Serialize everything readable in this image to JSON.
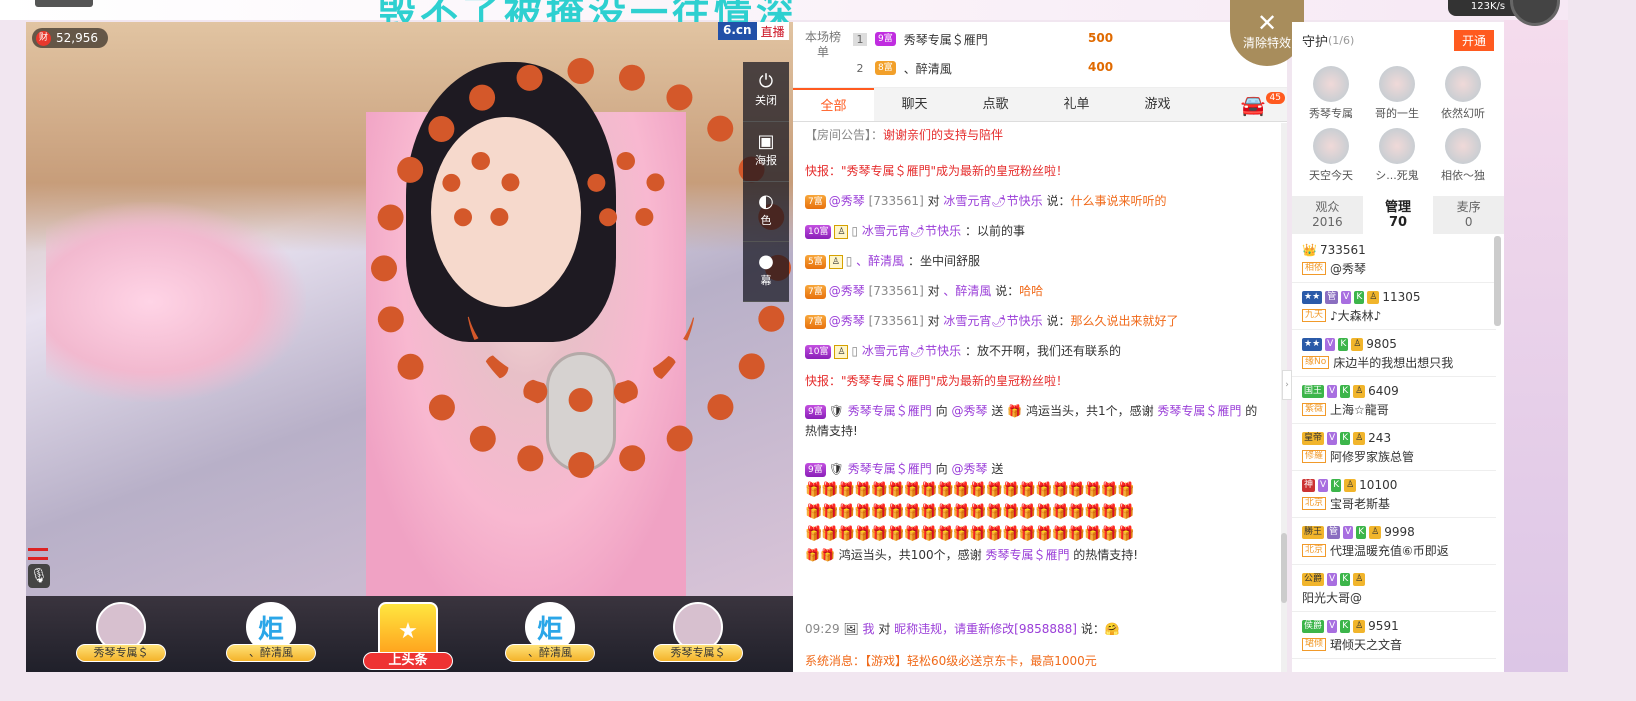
{
  "banner": {
    "text": "毁不了被掩没一往情深"
  },
  "video": {
    "wealth": "52,956",
    "wealth_icon": "财",
    "logo": "6.cn",
    "live": "直播"
  },
  "side_buttons": [
    {
      "label": "关闭",
      "icon": "power-icon"
    },
    {
      "label": "海报",
      "icon": "poster-icon"
    },
    {
      "label": "色",
      "icon": "palette-icon"
    },
    {
      "label": "幕",
      "icon": "screen-icon"
    }
  ],
  "gift_bar": [
    {
      "label": "秀琴专属＄"
    },
    {
      "label": "、醉清風",
      "glyph": "炬"
    },
    {
      "label": "上头条",
      "glyph": "★"
    },
    {
      "label": "、醉清風",
      "glyph": "炬"
    },
    {
      "label": "秀琴专属＄"
    }
  ],
  "rank": {
    "label": "本场榜单",
    "rows": [
      {
        "num": "1",
        "level": "9富",
        "name": "秀琴专属＄雁門",
        "coins": "500"
      },
      {
        "num": "2",
        "level": "8富",
        "name": "、醉清風",
        "coins": "400"
      }
    ]
  },
  "close_effects": "清除特效",
  "tabs": [
    {
      "label": "全部"
    },
    {
      "label": "聊天"
    },
    {
      "label": "点歌"
    },
    {
      "label": "礼单"
    },
    {
      "label": "游戏"
    }
  ],
  "car_badge": "45",
  "chat": {
    "notice_label": "【房间公告】：",
    "notice_text": "谢谢亲们的支持与陪伴",
    "flash1": "快报：\"秀琴专属＄雁門\"成为最新的皇冠粉丝啦！",
    "m1": {
      "level": "7富",
      "from": "@秀琴",
      "id": "[733561]",
      "to_word": "对",
      "to": "冰雪元宵🌶节快乐",
      "say": "说：",
      "text": "什么事说来听听的"
    },
    "m2": {
      "level": "10富",
      "name": "冰雪元宵🌶节快乐",
      "text": "：以前的事"
    },
    "m3": {
      "level": "5富",
      "name": "、醉清風",
      "text": "：坐中间舒服"
    },
    "m4": {
      "level": "7富",
      "from": "@秀琴",
      "id": "[733561]",
      "to_word": "对",
      "to": "、醉清風",
      "say": "说：",
      "text": "哈哈"
    },
    "m5": {
      "level": "7富",
      "from": "@秀琴",
      "id": "[733561]",
      "to_word": "对",
      "to": "冰雪元宵🌶节快乐",
      "say": "说：",
      "text": "那么久说出来就好了"
    },
    "m6": {
      "level": "10富",
      "name": "冰雪元宵🌶节快乐",
      "text": "：放不开啊，我们还有联系的"
    },
    "flash2": "快报：\"秀琴专属＄雁門\"成为最新的皇冠粉丝啦！",
    "g1": {
      "level": "9富",
      "from": "秀琴专属＄雁門",
      "mid": "向",
      "to": "@秀琴",
      "send": "送",
      "gift": "鸿运当头，共1个，感谢",
      "thank_name": "秀琴专属＄雁門",
      "tail": "的热情支持!"
    },
    "g2": {
      "level": "9富",
      "from": "秀琴专属＄雁門",
      "mid": "向",
      "to": "@秀琴",
      "send": "送",
      "gift": "鸿运当头，共100个，感谢",
      "thank_name": "秀琴专属＄雁門",
      "tail": "的热情支持!"
    },
    "t1": {
      "time": "09:29",
      "me": "我",
      "to_word": "对",
      "to": "昵称违规，请重新修改[9858888]",
      "say": "说：",
      "emoji": "🤗"
    },
    "sys": "系统消息：【游戏】轻松60级必送京东卡，最高1000元"
  },
  "guard": {
    "title": "守护",
    "count": "(1/6)",
    "open": "开通",
    "members": [
      "秀琴专属",
      "哥的一生",
      "依然幻听",
      "天空今天",
      "シ...死鬼",
      "相依～独"
    ]
  },
  "user_tabs": [
    {
      "label": "观众",
      "count": "2016"
    },
    {
      "label": "管理",
      "count": "70"
    },
    {
      "label": "麦序",
      "count": "0"
    }
  ],
  "users": [
    {
      "id": "733561",
      "tag": "相依",
      "name": "@秀琴"
    },
    {
      "id": "11305",
      "tag": "九天",
      "name": "♪大森林♪"
    },
    {
      "id": "9805",
      "tag": "缘No",
      "name": "床边半的我想出想只我"
    },
    {
      "id": "6409",
      "tag": "紫薇",
      "name": "上海☆龍哥"
    },
    {
      "id": "243",
      "tag": "修羅",
      "name": "阿修罗家族总管"
    },
    {
      "id": "10100",
      "tag": "北京",
      "name": "宝哥老斯基"
    },
    {
      "id": "9998",
      "tag": "北京",
      "name": "代理温暖充值⑥币即返"
    },
    {
      "id": "",
      "tag": "",
      "name": "阳光大哥@"
    },
    {
      "id": "9591",
      "tag": "珺倾",
      "name": "珺倾天之文音"
    }
  ],
  "net": "123K/s"
}
